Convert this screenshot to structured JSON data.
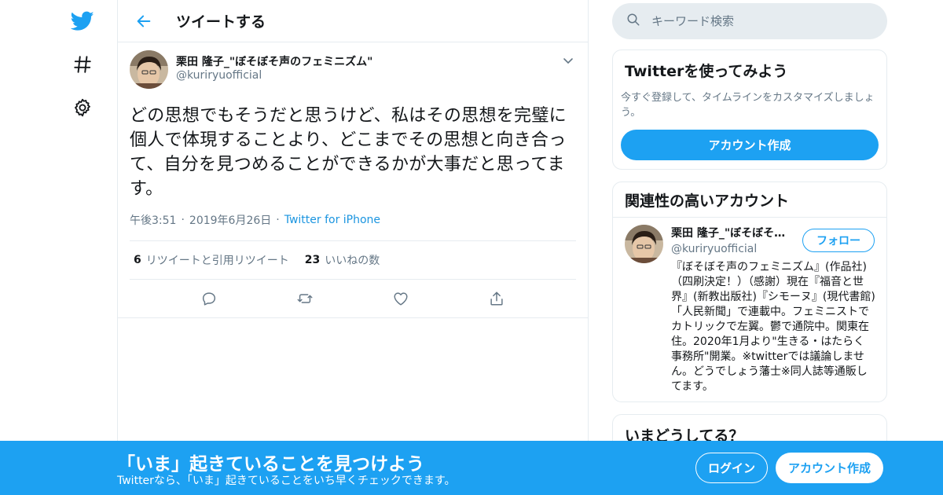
{
  "colors": {
    "brand": "#1da1f2",
    "link": "#1b95e0",
    "text_primary": "#14171a",
    "text_secondary": "#657786",
    "border": "#e6ecf0",
    "search_bg": "#e6ecf0"
  },
  "nav": {
    "icons": [
      "twitter-bird-icon",
      "hashtag-icon",
      "gear-icon"
    ]
  },
  "header": {
    "title": "ツイートする"
  },
  "tweet": {
    "author_name": "栗田 隆子_\"ぼそぼそ声のフェミニズム\"",
    "author_handle": "@kuriryuofficial",
    "text": "どの思想でもそうだと思うけど、私はその思想を完璧に個人で体現することより、どこまでその思想と向き合って、自分を見つめることができるかが大事だと思ってます。",
    "time": "午後3:51",
    "date": "2019年6月26日",
    "source": "Twitter for iPhone",
    "retweets_count": "6",
    "retweets_label": "リツイートと引用リツイート",
    "likes_count": "23",
    "likes_label": "いいねの数",
    "actions": [
      "reply-icon",
      "retweet-icon",
      "like-icon",
      "share-icon"
    ]
  },
  "search": {
    "placeholder": "キーワード検索"
  },
  "signup_card": {
    "title": "Twitterを使ってみよう",
    "description": "今すぐ登録して、タイムラインをカスタマイズしましょう。",
    "button": "アカウント作成"
  },
  "related_card": {
    "title": "関連性の高いアカウント",
    "user_name": "栗田 隆子_\"ぼそぼそ声のフェミニズム\"",
    "user_handle": "@kuriryuofficial",
    "follow_button": "フォロー",
    "bio": "『ぼそぼそ声のフェミニズム』(作品社)（四刷決定！）（感謝）現在『福音と世界』(新教出版社)『シモーヌ』(現代書館)「人民新聞」で連載中。フェミニストでカトリックで左翼。鬱で通院中。関東在住。2020年1月より\"生きる・はたらく事務所\"開業。※twitterでは議論しません。どうでしょう藩士※同人誌等通販してます。"
  },
  "trends_card": {
    "title": "いまどうしてる？"
  },
  "bottom_bar": {
    "title": "「いま」起きていることを見つけよう",
    "subtitle": "Twitterなら、「いま」起きていることをいち早くチェックできます。",
    "login_button": "ログイン",
    "signup_button": "アカウント作成"
  }
}
